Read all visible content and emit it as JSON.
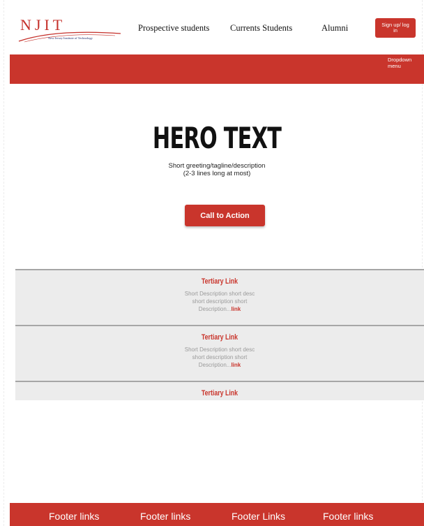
{
  "header": {
    "logo_text": "NJIT",
    "logo_subtitle": "New Jersey Institute of Technology",
    "nav": {
      "prospective": "Prospective students",
      "current": "Currents Students",
      "alumni": "Alumni"
    },
    "signup_label": "Sign up/ log in"
  },
  "redband": {
    "dropdown_label": "Dropdown menu"
  },
  "hero": {
    "title": "HERO TEXT",
    "description_lines": [
      "Short greeting/tagline/description",
      "(2-3 lines long at most)"
    ],
    "cta_label": "Call to Action"
  },
  "tertiary": {
    "items": [
      {
        "title": "Tertiary Link",
        "desc_lines": [
          "Short Description short desc",
          "short description short"
        ],
        "desc_tail": "Description...",
        "more": "link"
      },
      {
        "title": "Tertiary Link",
        "desc_lines": [
          "Short Description short desc",
          "short description short"
        ],
        "desc_tail": "Description...",
        "more": "link"
      },
      {
        "title": "Tertiary Link"
      }
    ]
  },
  "footer": {
    "links": [
      "Footer links",
      "Footer links",
      "Footer Links",
      "Footer links"
    ]
  },
  "colors": {
    "brand_red": "#c9352c",
    "logo_navy": "#1d2a6b",
    "section_gray": "#ececec"
  }
}
